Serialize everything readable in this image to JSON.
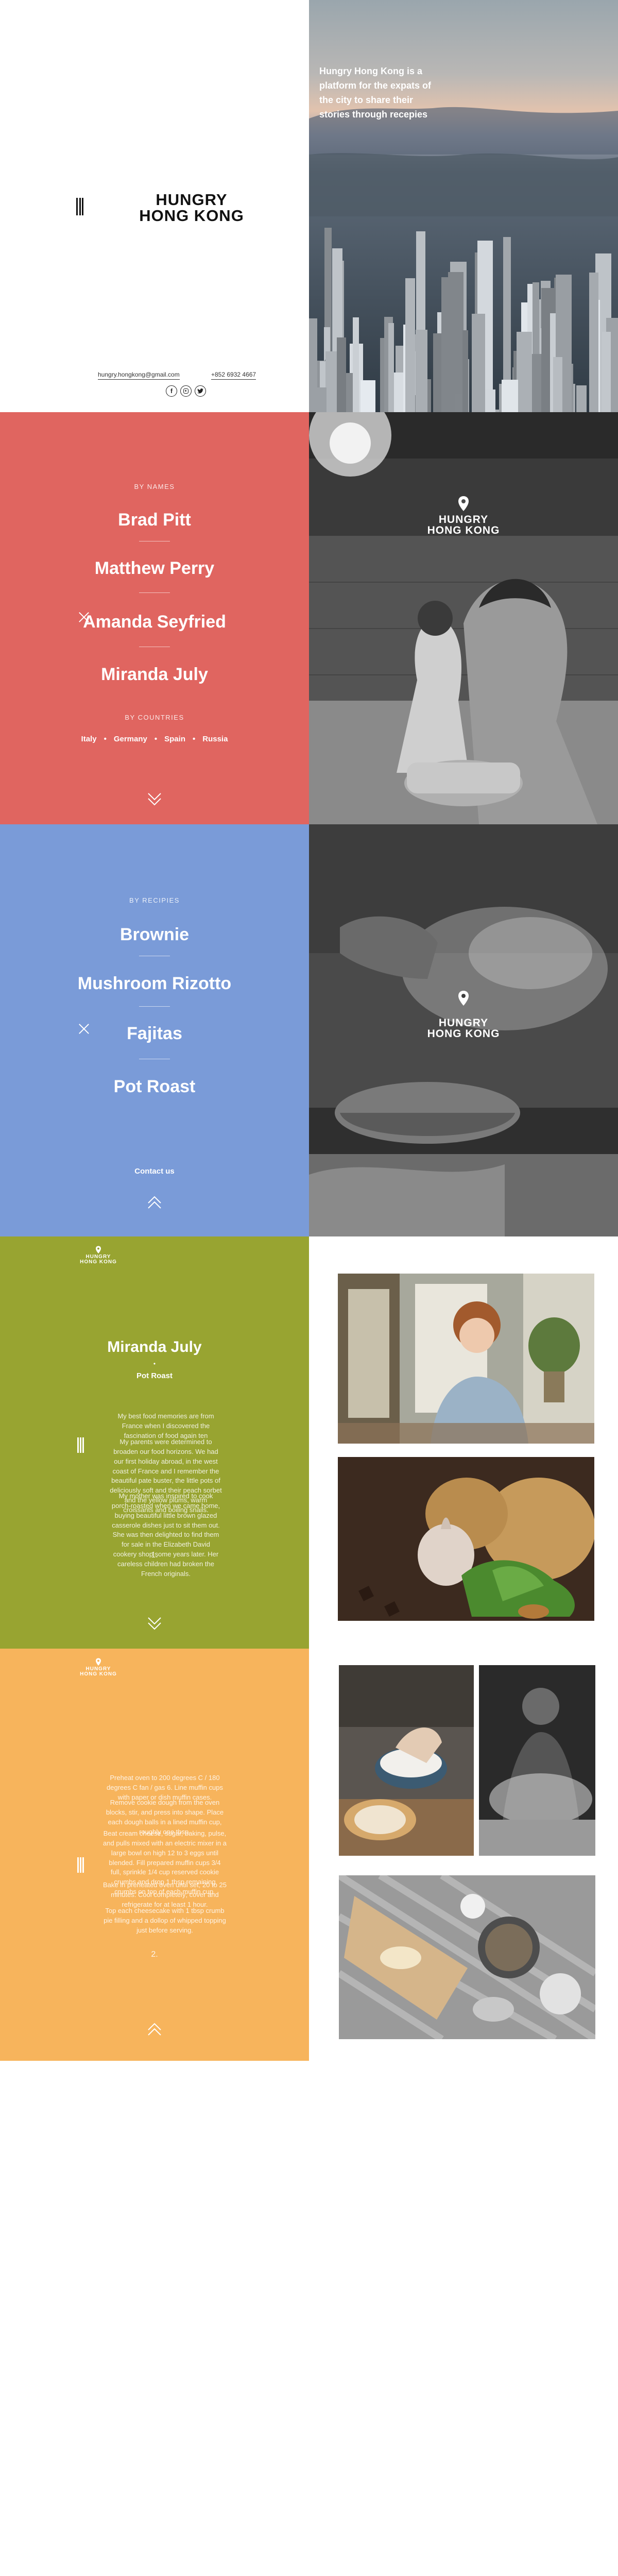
{
  "brand": {
    "line1": "HUNGRY",
    "line2": "HONG KONG"
  },
  "hero": {
    "headline": "Hungry Hong Kong is a platform for the expats of the city to share their stories through recepies",
    "email": "hungry.hongkong@gmail.com",
    "phone": "+852 6932 4667",
    "social_icons": [
      "facebook-icon",
      "instagram-icon",
      "twitter-icon"
    ]
  },
  "names_menu": {
    "heading_names": "BY NAMES",
    "names": [
      "Brad Pitt",
      "Matthew Perry",
      "Amanda Seyfried",
      "Miranda July"
    ],
    "heading_countries": "BY COUNTRIES",
    "countries": [
      "Italy",
      "Germany",
      "Spain",
      "Russia"
    ]
  },
  "recipes_menu": {
    "heading": "BY RECIPIES",
    "recipes": [
      "Brownie",
      "Mushroom Rizotto",
      "Fajitas",
      "Pot Roast"
    ],
    "contact": "Contact us"
  },
  "story": {
    "name": "Miranda July",
    "dot": "•",
    "recipe": "Pot Roast",
    "p1": "My best food memories are from France when I discovered the fascination of food again ten",
    "p2": "My parents were determined to broaden our food horizons. We had our first holiday abroad, in the west coast of France and I remember the beautiful pate buster, the little pots of deliciously soft and their peach sorbet and the yellow plums, warm croissants and boiling snails.",
    "p3": "My mother was inspired to cook porch-roasted when we came home, buying beautiful little brown glazed casserole dishes just to sit them out. She was then delighted to find them for sale in the Elizabeth David cookery shop some years later. Her careless children had broken the French originals.",
    "page_num": "1."
  },
  "method": {
    "p1": "Preheat oven to 200 degrees C / 180 degrees C fan / gas 6. Line muffin cups with paper or dish muffin cases.",
    "p2": "Remove cookie dough from the oven blocks, stir, and press into shape. Place each dough balls in a lined muffin cup, roughly one tbsp.",
    "p3": "Beat cream cheese, sugar, baking, pulse, and pulls mixed with an electric mixer in a large bowl on high 12 to 3 eggs until blended. Fill prepared muffin cups 3/4 full, sprinkle 1/4 cup reserved cookie crumbs and drop 1 tbsp remaining crumbs on top of each muffin cup.",
    "p4": "Bake in preheated oven until set, 20 to 25 minutes. Cool completely; cover and refrigerate for at least 1 hour.",
    "p5": "Top each cheesecake with 1 tbsp crumb pie filling and a dollop of whipped topping just before serving.",
    "page_num": "2."
  },
  "colors": {
    "red": "#e06560",
    "blue": "#7a9bd8",
    "olive": "#98a431",
    "orange": "#f7b45c"
  }
}
